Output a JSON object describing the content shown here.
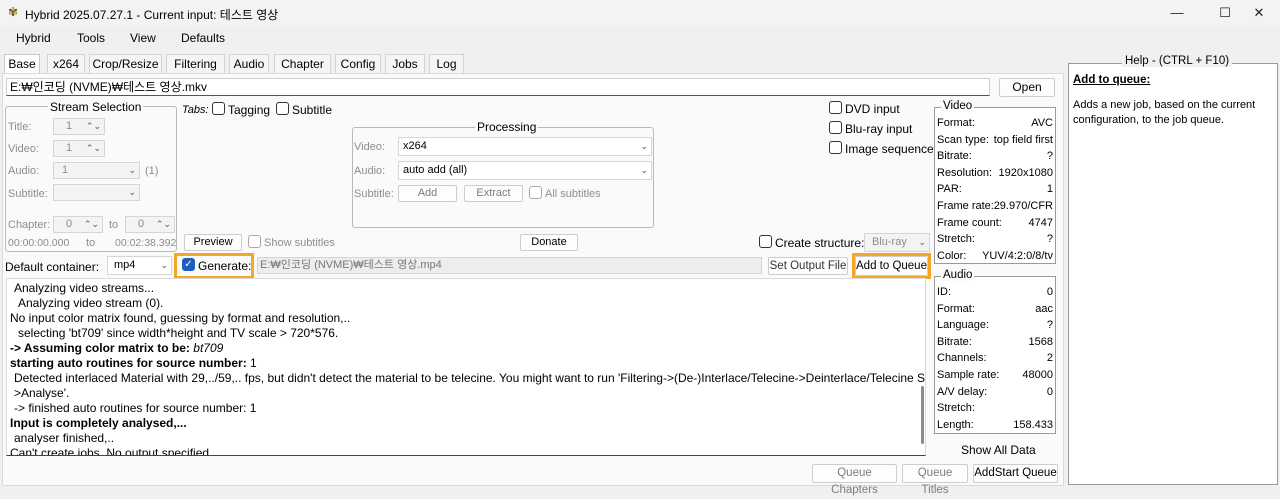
{
  "window": {
    "title": "Hybrid 2025.07.27.1 - Current input: 테스트 영상",
    "minimize_glyph": "—",
    "maximize_glyph": "☐",
    "close_glyph": "✕"
  },
  "menu": [
    "Hybrid",
    "Tools",
    "View",
    "Defaults"
  ],
  "tabs": [
    "Base",
    "x264",
    "Crop/Resize",
    "Filtering",
    "Audio",
    "Chapter",
    "Config",
    "Jobs",
    "Log"
  ],
  "input_path": "E:₩인코딩 (NVME)₩테스트 영상.mkv",
  "open_label": "Open",
  "stream_selection": {
    "title": "Stream Selection",
    "title_label": "Title:",
    "title_value": "1",
    "video_label": "Video:",
    "video_value": "1",
    "audio_label": "Audio:",
    "audio_value": "1",
    "audio_count": "(1)",
    "subtitle_label": "Subtitle:",
    "chapter_label": "Chapter:",
    "chapter_from": "0",
    "chapter_to_label": "to",
    "chapter_to": "0",
    "time_from": "00:00:00.000",
    "time_to_label": "to",
    "time_to": "00:02:38.392"
  },
  "tabs_option": {
    "label": "Tabs:",
    "tagging": "Tagging",
    "subtitle": "Subtitle"
  },
  "processing": {
    "title": "Processing",
    "video_label": "Video:",
    "video_value": "x264",
    "audio_label": "Audio:",
    "audio_value": "auto add (all)",
    "subtitle_label": "Subtitle:",
    "add": "Add",
    "extract": "Extract",
    "all_subtitles": "All subtitles"
  },
  "source_type": {
    "dvd": "DVD input",
    "bluray": "Blu-ray input",
    "image_seq": "Image sequence"
  },
  "preview_label": "Preview",
  "show_subtitles": "Show subtitles",
  "donate_label": "Donate",
  "create_structure": {
    "label": "Create structure:",
    "value": "Blu-ray"
  },
  "default_container": {
    "label": "Default container:",
    "value": "mp4"
  },
  "generate": {
    "label": "Generate:",
    "checked": true
  },
  "output_path": "E:₩인코딩 (NVME)₩테스트 영상.mp4",
  "set_output_file": "Set Output File",
  "add_to_queue": "Add to Queue",
  "log_lines": [
    {
      "text": "Analyzing video streams...",
      "indent": 1,
      "bold": false
    },
    {
      "text": "Analyzing video stream (0).",
      "indent": 2,
      "bold": false
    },
    {
      "text": "No input color matrix found, guessing by format and resolution,..",
      "indent": 0,
      "bold": false
    },
    {
      "text": "selecting 'bt709' since width*height and TV scale > 720*576.",
      "indent": 2,
      "bold": false
    },
    {
      "text": "-> Assuming color matrix to be: ",
      "indent": 0,
      "bold": true,
      "italic_suffix": "bt709"
    },
    {
      "text": "starting auto routines for source number:",
      "indent": 0,
      "bold": true,
      "suffix": " 1"
    },
    {
      "text": "Detected interlaced Material with 29,../59,.. fps, but didn't detect the material to be telecine. You might want to run 'Filtering->(De-)Interlace/Telecine->Deinterlace/Telecine Settings-",
      "indent": 1,
      "bold": false
    },
    {
      "text": ">Analyse'.",
      "indent": 1,
      "bold": false
    },
    {
      "text": "-> finished auto routines for source number: 1",
      "indent": 1,
      "bold": false
    },
    {
      "text": "Input is completely analysed,...",
      "indent": 0,
      "bold": true
    },
    {
      "text": "analyser finished,..",
      "indent": 1,
      "bold": false
    },
    {
      "text": "Can't create jobs. No output specified...",
      "indent": 0,
      "bold": false
    }
  ],
  "video_info": {
    "title": "Video",
    "rows": [
      {
        "k": "Format:",
        "v": "AVC"
      },
      {
        "k": "Scan type:",
        "v": "top field first"
      },
      {
        "k": "Bitrate:",
        "v": "?"
      },
      {
        "k": "Resolution:",
        "v": "1920x1080"
      },
      {
        "k": "PAR:",
        "v": "1"
      },
      {
        "k": "Frame rate:",
        "v": "29.970/CFR"
      },
      {
        "k": "Frame count:",
        "v": "4747"
      },
      {
        "k": "Stretch:",
        "v": "?"
      },
      {
        "k": "Color:",
        "v": "YUV/4:2:0/8/tv"
      }
    ]
  },
  "audio_info": {
    "title": "Audio",
    "rows": [
      {
        "k": "ID:",
        "v": "0"
      },
      {
        "k": "Format:",
        "v": "aac"
      },
      {
        "k": "Language:",
        "v": "?"
      },
      {
        "k": "Bitrate:",
        "v": "1568"
      },
      {
        "k": "Channels:",
        "v": "2"
      },
      {
        "k": "Sample rate:",
        "v": "48000"
      },
      {
        "k": "A/V delay:",
        "v": "0"
      },
      {
        "k": "Stretch:",
        "v": ""
      },
      {
        "k": "Length:",
        "v": "158.433"
      }
    ]
  },
  "show_all_data": "Show All Data",
  "bottom": {
    "queue_chapters": "Queue Chapters",
    "queue_titles": "Queue Titles",
    "add_start_queue": "AddStart Queue"
  },
  "help": {
    "title": "Help - (CTRL + F10)",
    "heading": "Add to queue:",
    "body": "Adds a new job, based on the current configuration, to the job queue."
  },
  "colors": {
    "highlight": "#f5a623",
    "checkbox_checked": "#1d5fbf"
  }
}
